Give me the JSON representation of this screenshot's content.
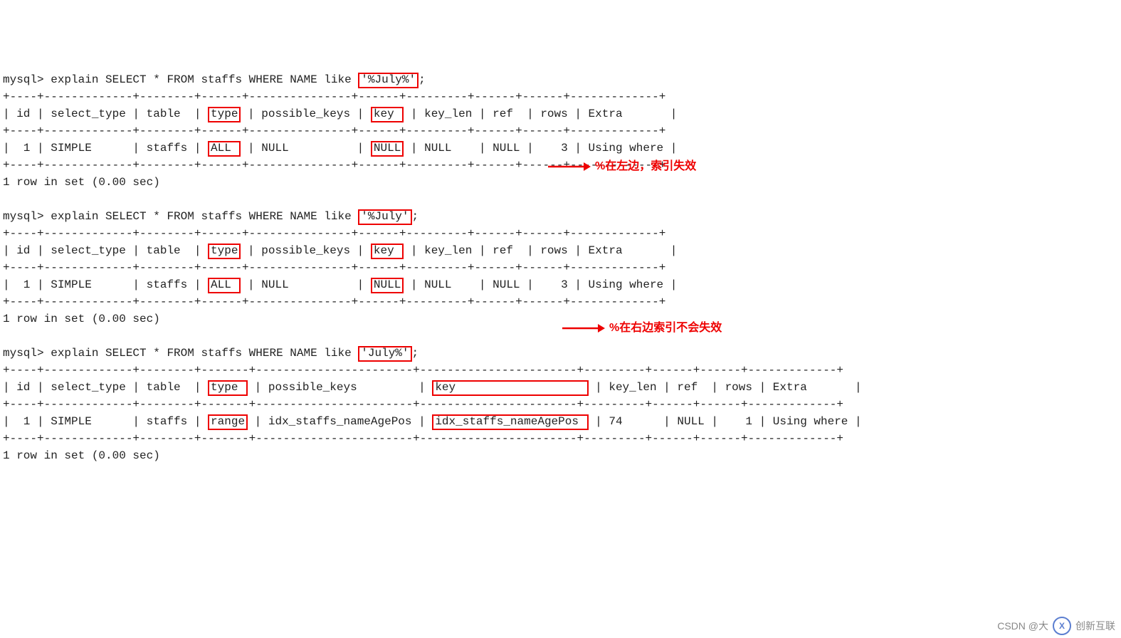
{
  "q1": {
    "prompt": "mysql> explain SELECT * FROM staffs WHERE NAME like ",
    "literal": "'%July%'",
    "tail": ";",
    "sep1": "+----+-------------+--------+------+---------------+------+---------+------+------+-------------+",
    "hdr": "| id | select_type | table  | type | possible_keys | key  | key_len | ref  | rows | Extra       |",
    "sep2": "+----+-------------+--------+------+---------------+------+---------+------+------+-------------+",
    "row_id": "|  1 | SIMPLE      | staffs | ",
    "row_type": "ALL ",
    "row_mid": " | NULL          | ",
    "row_key": "NULL",
    "row_tail": " | NULL    | NULL |    3 | Using where |",
    "sep3": "+----+-------------+--------+------+---------------+------+---------+------+------+-------------+",
    "foot": "1 row in set (0.00 sec)",
    "hdr_pre": "| id | select_type | table  | ",
    "hdr_type": "type",
    "hdr_mid": " | possible_keys | ",
    "hdr_key": "key ",
    "hdr_tail": " | key_len | ref  | rows | Extra       |"
  },
  "q2": {
    "prompt": "mysql> explain SELECT * FROM staffs WHERE NAME like ",
    "literal": "'%July'",
    "tail": ";",
    "sep1": "+----+-------------+--------+------+---------------+------+---------+------+------+-------------+",
    "hdr_pre": "| id | select_type | table  | ",
    "hdr_type": "type",
    "hdr_mid": " | possible_keys | ",
    "hdr_key": "key ",
    "hdr_tail": " | key_len | ref  | rows | Extra       |",
    "sep2": "+----+-------------+--------+------+---------------+------+---------+------+------+-------------+",
    "row_id": "|  1 | SIMPLE      | staffs | ",
    "row_type": "ALL ",
    "row_mid": " | NULL          | ",
    "row_key": "NULL",
    "row_tail": " | NULL    | NULL |    3 | Using where |",
    "sep3": "+----+-------------+--------+------+---------------+------+---------+------+------+-------------+",
    "foot": "1 row in set (0.00 sec)",
    "note": "%在左边，索引失效"
  },
  "q3": {
    "prompt": "mysql> explain SELECT * FROM staffs WHERE NAME like ",
    "literal": "'July%'",
    "tail": ";",
    "sep1": "+----+-------------+--------+-------+-----------------------+-----------------------+---------+------+------+-------------+",
    "hdr_pre": "| id | select_type | table  | ",
    "hdr_type": "type ",
    "hdr_mid": " | possible_keys         | ",
    "hdr_key": "key                   ",
    "hdr_tail": " | key_len | ref  | rows | Extra       |",
    "sep2": "+----+-------------+--------+-------+-----------------------+-----------------------+---------+------+------+-------------+",
    "row_id": "|  1 | SIMPLE      | staffs | ",
    "row_type": "range",
    "row_mid": " | idx_staffs_nameAgePos | ",
    "row_key": "idx_staffs_nameAgePos ",
    "row_tail": " | 74      | NULL |    1 | Using where |",
    "sep3": "+----+-------------+--------+-------+-----------------------+-----------------------+---------+------+------+-------------+",
    "foot": "1 row in set (0.00 sec)",
    "note": "%在右边索引不会失效"
  },
  "watermark": {
    "csdn": "CSDN @大",
    "brand": "创新互联"
  }
}
